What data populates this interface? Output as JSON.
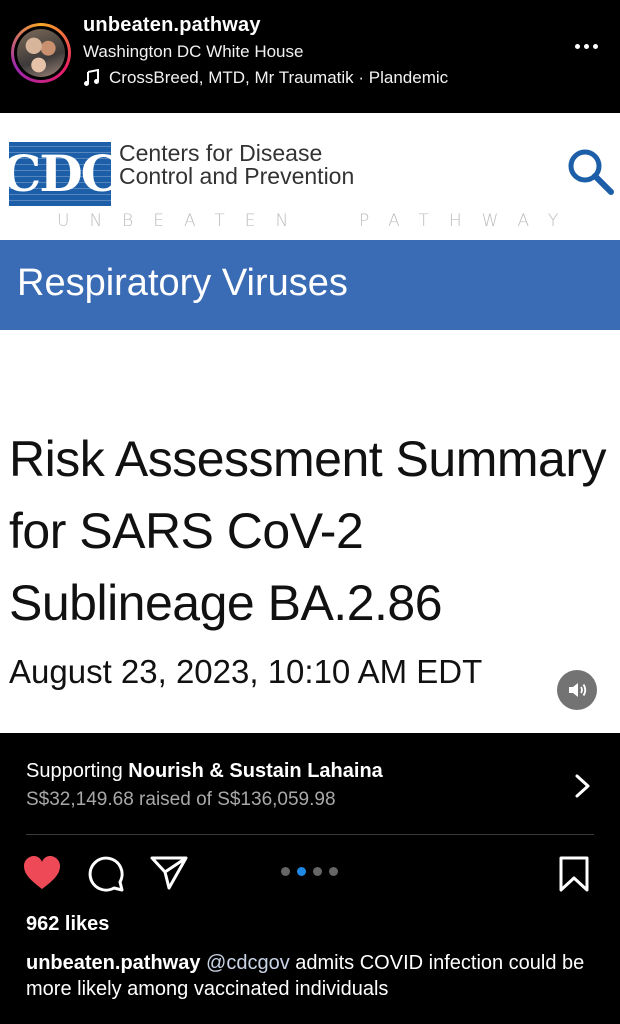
{
  "header": {
    "username": "unbeaten.pathway",
    "location": "Washington DC  White House",
    "audio": "CrossBreed, MTD, Mr Traumatik · Plandemic",
    "avatar_icon": "avatar-icon",
    "more_icon": "more-icon"
  },
  "post_image": {
    "logo_text": "CDC",
    "org_line1": "Centers for Disease",
    "org_line2": "Control and Prevention",
    "watermark": "UNBEATEN  PATHWAY",
    "section_title": "Respiratory Viruses",
    "article_title": "Risk Assessment Summary for SARS CoV-2 Sublineage BA.2.86",
    "article_date": "August 23, 2023, 10:10 AM EDT",
    "sound_icon": "speaker-icon",
    "brand_color": "#1c5fa8",
    "banner_color": "#3a6bb5"
  },
  "fundraiser": {
    "prefix": "Supporting ",
    "cause": "Nourish & Sustain Lahaina",
    "raised": "S$32,149.68 raised of S$136,059.98"
  },
  "actions": {
    "like_icon": "heart-icon",
    "comment_icon": "comment-icon",
    "share_icon": "send-icon",
    "save_icon": "bookmark-icon",
    "like_color": "#ed4956",
    "carousel_total": 4,
    "carousel_active": 2
  },
  "likes": "962 likes",
  "caption": {
    "username": "unbeaten.pathway",
    "mention": "@cdcgov",
    "text": " admits COVID infection could be more likely among vaccinated individuals"
  }
}
